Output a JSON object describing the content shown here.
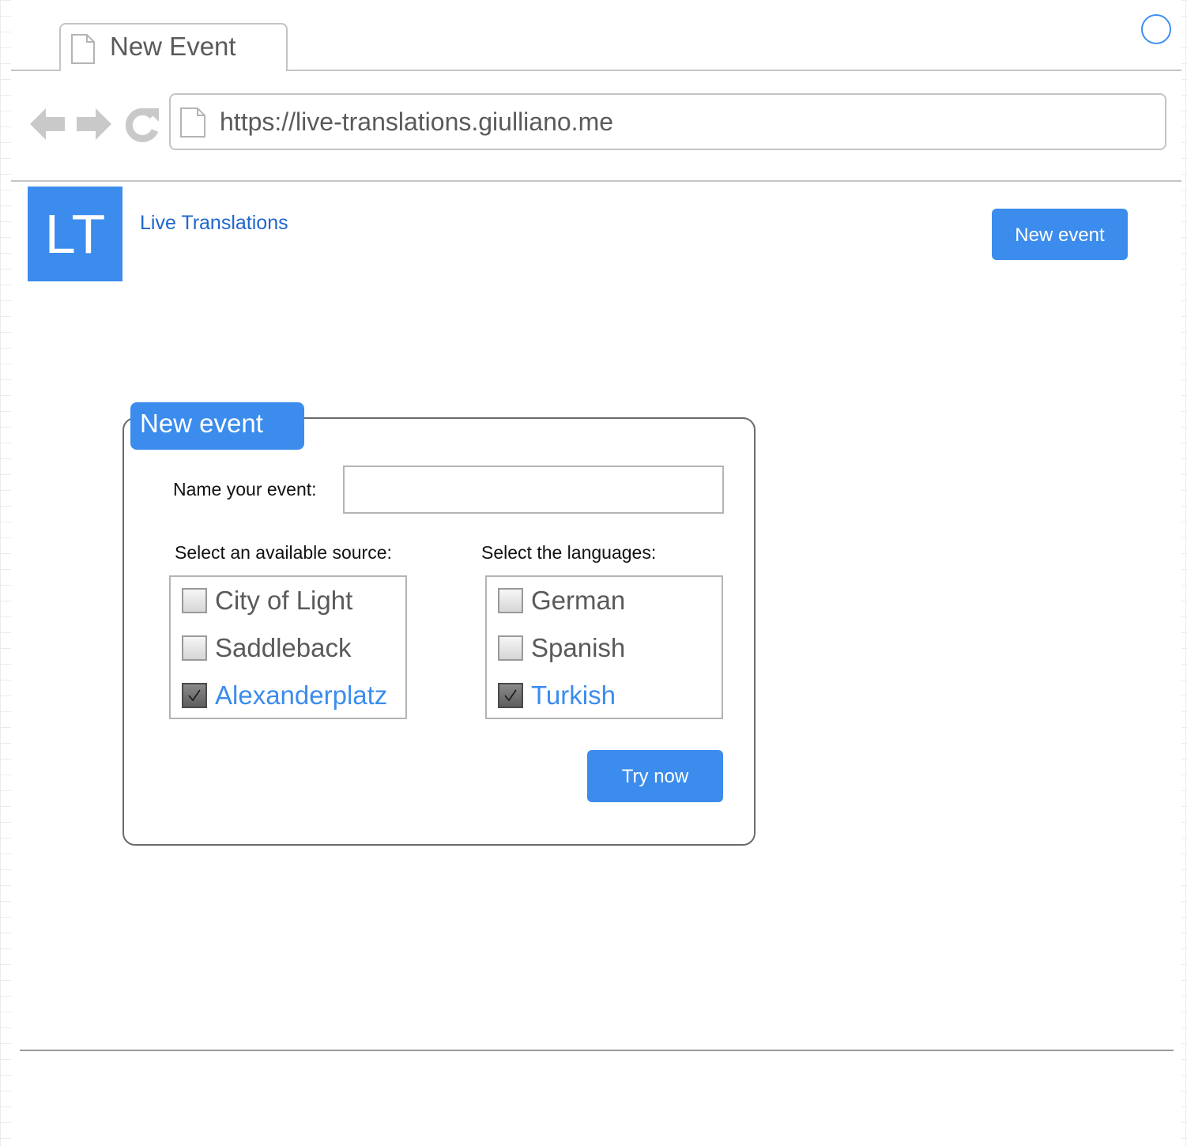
{
  "browser": {
    "tab_title": "New Event",
    "url": "https://live-translations.giulliano.me"
  },
  "header": {
    "logo_text": "LT",
    "app_name": "Live Translations",
    "new_event_button": "New event"
  },
  "form": {
    "title": "New event",
    "name_label": "Name your event:",
    "name_value": "",
    "source_label": "Select an available source:",
    "sources": [
      {
        "label": "City of Light",
        "checked": false
      },
      {
        "label": "Saddleback",
        "checked": false
      },
      {
        "label": "Alexanderplatz",
        "checked": true
      }
    ],
    "languages_label": "Select the languages:",
    "languages": [
      {
        "label": "German",
        "checked": false
      },
      {
        "label": "Spanish",
        "checked": false
      },
      {
        "label": "Turkish",
        "checked": true
      }
    ],
    "submit_button": "Try now"
  },
  "colors": {
    "accent": "#3b8ced",
    "link": "#1f66cc",
    "window_control": "#3f8ef0"
  },
  "icons": {
    "tab": "document-icon",
    "address": "document-icon",
    "back": "arrow-left-icon",
    "forward": "arrow-right-icon",
    "reload": "reload-icon",
    "check": "checkmark-icon"
  }
}
